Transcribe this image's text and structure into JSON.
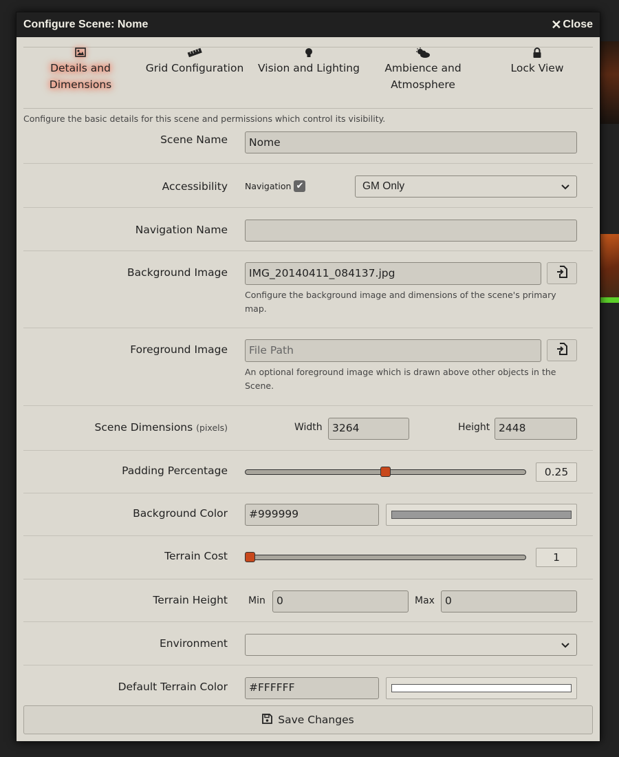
{
  "dialog": {
    "title": "Configure Scene: Nome",
    "close_label": "Close"
  },
  "tabs": [
    {
      "label": "Details and Dimensions",
      "icon": "image-icon",
      "active": true
    },
    {
      "label": "Grid Configuration",
      "icon": "ruler-icon",
      "active": false
    },
    {
      "label": "Vision and Lighting",
      "icon": "lightbulb-icon",
      "active": false
    },
    {
      "label": "Ambience and Atmosphere",
      "icon": "cloud-sun-icon",
      "active": false
    },
    {
      "label": "Lock View",
      "icon": "lock-icon",
      "active": false
    }
  ],
  "description": "Configure the basic details for this scene and permissions which control its visibility.",
  "fields": {
    "scene_name": {
      "label": "Scene Name",
      "value": "Nome"
    },
    "accessibility": {
      "label": "Accessibility",
      "navigation_label": "Navigation",
      "navigation_checked": true,
      "permission_value": "GM Only"
    },
    "navigation_name": {
      "label": "Navigation Name",
      "value": ""
    },
    "background_image": {
      "label": "Background Image",
      "value": "IMG_20140411_084137.jpg",
      "hint": "Configure the background image and dimensions of the scene's primary map."
    },
    "foreground_image": {
      "label": "Foreground Image",
      "placeholder": "File Path",
      "hint": "An optional foreground image which is drawn above other objects in the Scene."
    },
    "dimensions": {
      "label": "Scene Dimensions",
      "unit": "(pixels)",
      "width_label": "Width",
      "width_value": "3264",
      "height_label": "Height",
      "height_value": "2448"
    },
    "padding": {
      "label": "Padding Percentage",
      "value": "0.25",
      "fraction": 0.5
    },
    "background_color": {
      "label": "Background Color",
      "value": "#999999",
      "swatch": "#999999"
    },
    "terrain_cost": {
      "label": "Terrain Cost",
      "value": "1",
      "fraction": 0.0
    },
    "terrain_height": {
      "label": "Terrain Height",
      "min_label": "Min",
      "min_value": "0",
      "max_label": "Max",
      "max_value": "0"
    },
    "environment": {
      "label": "Environment",
      "value": ""
    },
    "default_terrain_color": {
      "label": "Default Terrain Color",
      "value": "#FFFFFF",
      "swatch": "#FFFFFF"
    }
  },
  "save_label": "Save Changes",
  "colors": {
    "accent": "#c8481c",
    "header_bg": "#202020",
    "panel_bg": "#dcd9d0"
  }
}
